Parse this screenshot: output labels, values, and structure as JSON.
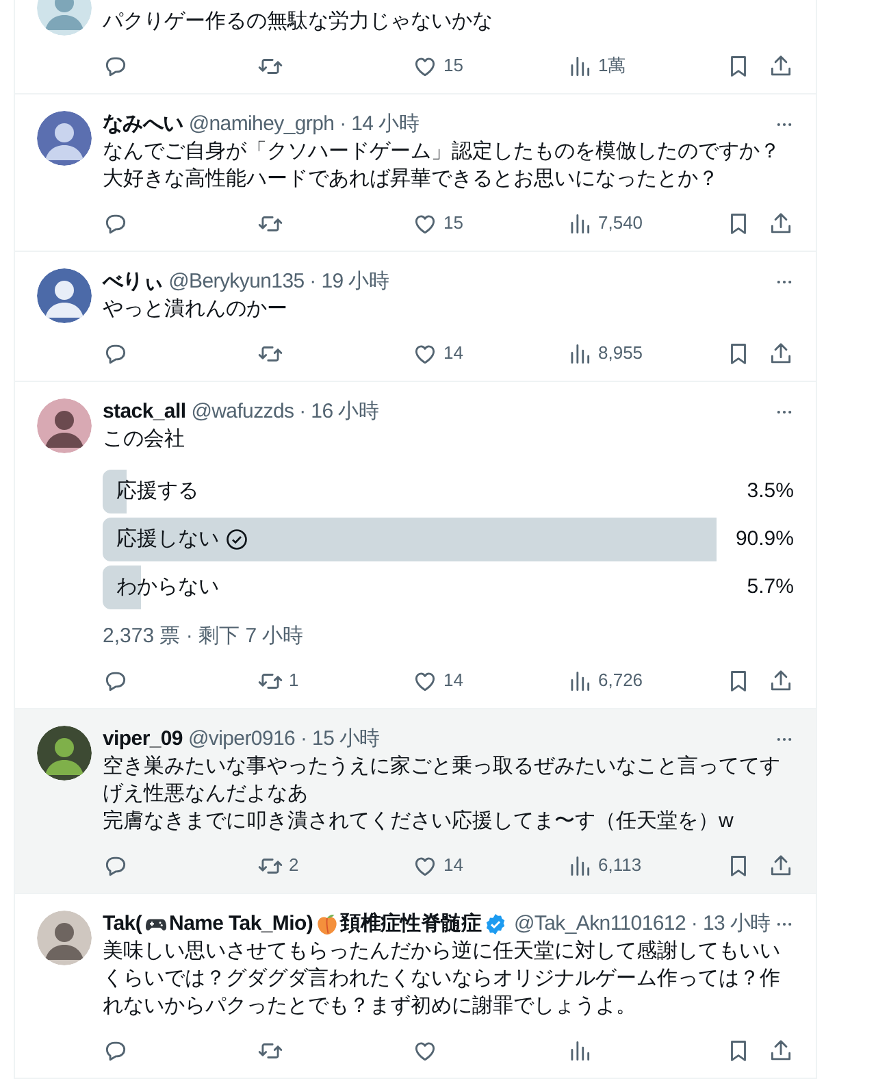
{
  "tweets": [
    {
      "hovered": false,
      "text": "パクりゲー作るの無駄な労力じゃないかな",
      "actions": [
        {
          "kind": "reply"
        },
        {
          "kind": "retweet"
        },
        {
          "kind": "like",
          "count": "15"
        },
        {
          "kind": "views",
          "count": "1萬"
        }
      ]
    },
    {
      "hovered": false,
      "name": [
        {
          "kind": "text",
          "text": "なみへい"
        }
      ],
      "verified": false,
      "meta": "@namihey_grph · 14 小時",
      "text": "なんでご自身が「クソハードゲーム」認定したものを模倣したのですか？大好きな高性能ハードであれば昇華できるとお思いになったとか？",
      "actions": [
        {
          "kind": "reply"
        },
        {
          "kind": "retweet"
        },
        {
          "kind": "like",
          "count": "15"
        },
        {
          "kind": "views",
          "count": "7,540"
        }
      ]
    },
    {
      "hovered": false,
      "name": [
        {
          "kind": "text",
          "text": "べりぃ"
        }
      ],
      "verified": false,
      "meta": "@Berykyun135 · 19 小時",
      "text": "やっと潰れんのかー",
      "actions": [
        {
          "kind": "reply"
        },
        {
          "kind": "retweet"
        },
        {
          "kind": "like",
          "count": "14"
        },
        {
          "kind": "views",
          "count": "8,955"
        }
      ]
    },
    {
      "hovered": false,
      "name": [
        {
          "kind": "text",
          "text": "stack_all"
        }
      ],
      "verified": false,
      "meta": "@wafuzzds · 16 小時",
      "text": "この会社",
      "poll": {
        "options": [
          {
            "label": "応援する",
            "percent": "3.5%",
            "selected": false
          },
          {
            "label": "応援しない",
            "percent": "90.9%",
            "selected": true
          },
          {
            "label": "わからない",
            "percent": "5.7%",
            "selected": false
          }
        ],
        "footer": "2,373 票 · 剩下 7 小時"
      },
      "actions": [
        {
          "kind": "reply"
        },
        {
          "kind": "retweet",
          "count": "1"
        },
        {
          "kind": "like",
          "count": "14"
        },
        {
          "kind": "views",
          "count": "6,726"
        }
      ]
    },
    {
      "hovered": true,
      "name": [
        {
          "kind": "text",
          "text": "viper_09"
        }
      ],
      "verified": false,
      "meta": "@viper0916 · 15 小時",
      "text": "空き巣みたいな事やったうえに家ごと乗っ取るぜみたいなこと言っててすげえ性悪なんだよなあ",
      "text_2": "完膚なきまでに叩き潰されてください応援してま〜す（任天堂を）w",
      "actions": [
        {
          "kind": "reply"
        },
        {
          "kind": "retweet",
          "count": "2"
        },
        {
          "kind": "like",
          "count": "14"
        },
        {
          "kind": "views",
          "count": "6,113"
        }
      ]
    },
    {
      "hovered": false,
      "name": [
        {
          "kind": "text",
          "text": "Tak("
        },
        {
          "kind": "gamepad"
        },
        {
          "kind": "text",
          "text": "Name Tak_Mio)"
        },
        {
          "kind": "peach"
        },
        {
          "kind": "text",
          "text": "頚椎症性脊髄症"
        }
      ],
      "verified": true,
      "meta": "@Tak_Akn1101612 · 13 小時",
      "text": "美味しい思いさせてもらったんだから逆に任天堂に対して感謝してもいいくらいでは？グダグダ言われたくないならオリジナルゲーム作っては？作れないからパクったとでも？まず初めに謝罪でしょうよ。",
      "actions": [
        {
          "kind": "reply"
        },
        {
          "kind": "retweet"
        },
        {
          "kind": "like"
        },
        {
          "kind": "views"
        }
      ]
    }
  ]
}
